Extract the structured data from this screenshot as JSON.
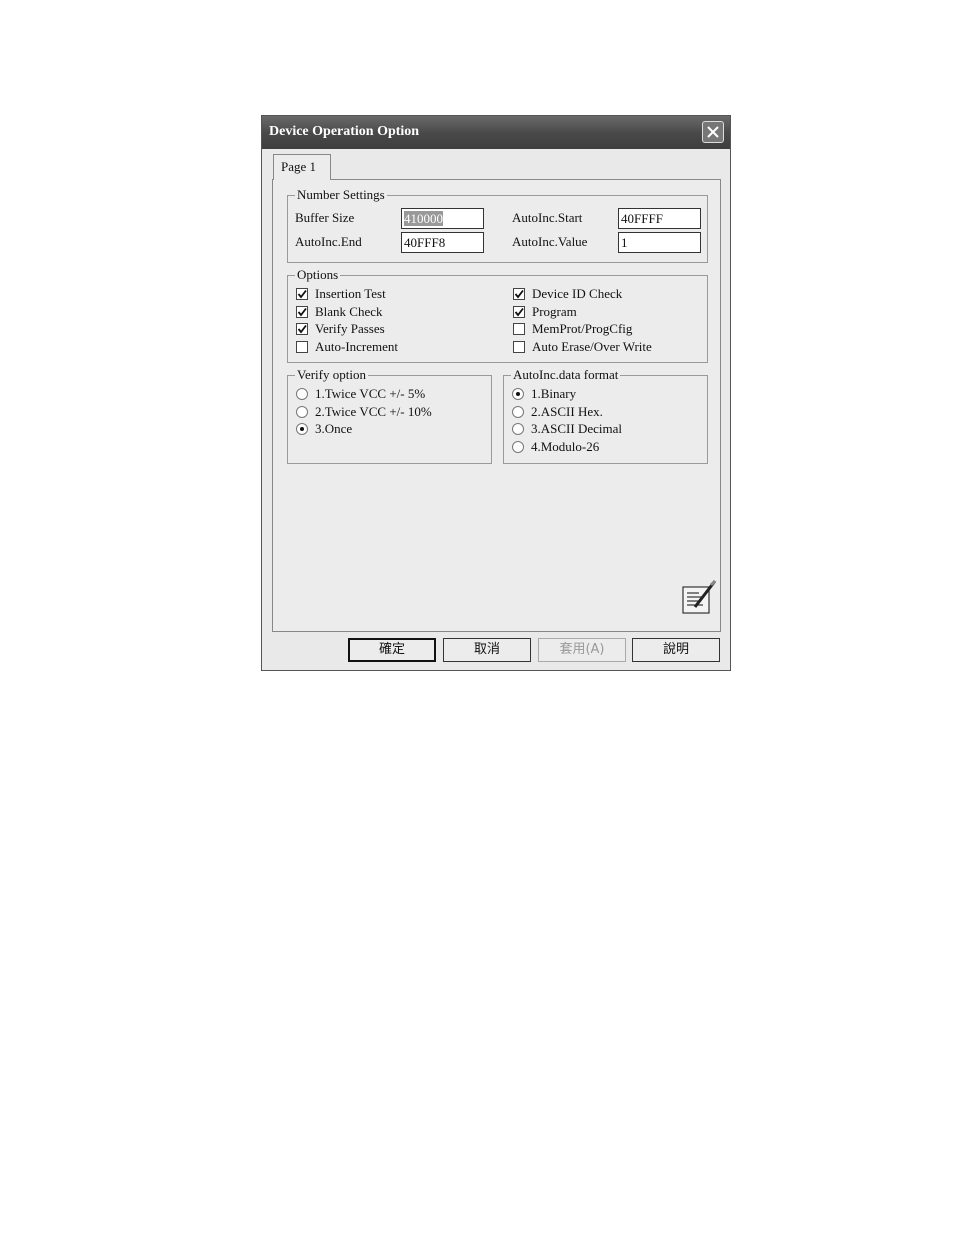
{
  "window": {
    "title": "Device Operation Option",
    "tab": "Page 1"
  },
  "number_settings": {
    "legend": "Number Settings",
    "buffer_size_label": "Buffer Size",
    "buffer_size_value": "410000",
    "autoinc_start_label": "AutoInc.Start",
    "autoinc_start_value": "40FFFF",
    "autoinc_end_label": "AutoInc.End",
    "autoinc_end_value": "40FFF8",
    "autoinc_value_label": "AutoInc.Value",
    "autoinc_value_value": "1"
  },
  "options": {
    "legend": "Options",
    "items": [
      {
        "label": "Insertion Test",
        "checked": true
      },
      {
        "label": "Blank Check",
        "checked": true
      },
      {
        "label": "Verify Passes",
        "checked": true
      },
      {
        "label": "Auto-Increment",
        "checked": false
      },
      {
        "label": "Device ID Check",
        "checked": true
      },
      {
        "label": "Program",
        "checked": true
      },
      {
        "label": "MemProt/ProgCfig",
        "checked": false
      },
      {
        "label": "Auto Erase/Over Write",
        "checked": false
      }
    ]
  },
  "verify_option": {
    "legend": "Verify option",
    "items": [
      {
        "label": "1.Twice VCC +/- 5%",
        "selected": false
      },
      {
        "label": "2.Twice VCC +/- 10%",
        "selected": false
      },
      {
        "label": "3.Once",
        "selected": true
      }
    ]
  },
  "autoinc_format": {
    "legend": "AutoInc.data format",
    "items": [
      {
        "label": "1.Binary",
        "selected": true
      },
      {
        "label": "2.ASCII Hex.",
        "selected": false
      },
      {
        "label": "3.ASCII Decimal",
        "selected": false
      },
      {
        "label": "4.Modulo-26",
        "selected": false
      }
    ]
  },
  "buttons": {
    "ok": "確定",
    "cancel": "取消",
    "apply": "套用(A)",
    "help": "說明"
  },
  "icons": {
    "close": "close-icon",
    "wizard": "wizard-icon"
  }
}
